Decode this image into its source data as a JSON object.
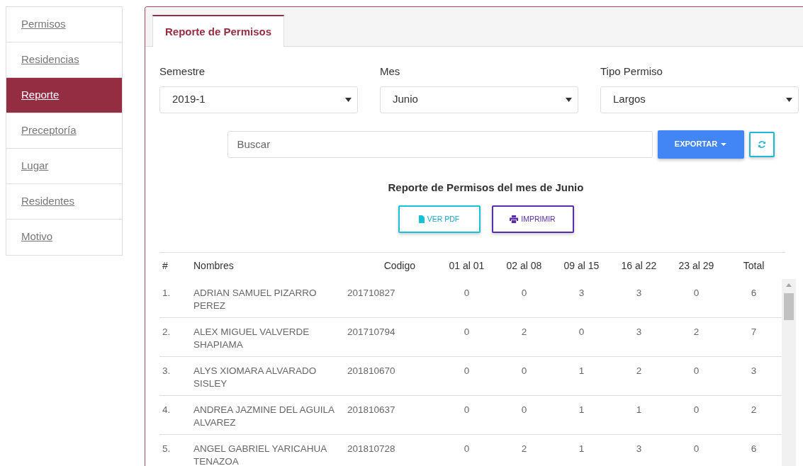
{
  "sidebar": {
    "items": [
      {
        "label": "Permisos",
        "selected": false
      },
      {
        "label": "Residencias",
        "selected": false
      },
      {
        "label": "Reporte",
        "selected": true
      },
      {
        "label": "Preceptoría",
        "selected": false
      },
      {
        "label": "Lugar",
        "selected": false
      },
      {
        "label": "Residentes",
        "selected": false
      },
      {
        "label": "Motivo",
        "selected": false
      }
    ]
  },
  "tabs": [
    {
      "label": "Reporte de Permisos",
      "selected": true
    }
  ],
  "filters": [
    {
      "label": "Semestre",
      "value": "2019-1"
    },
    {
      "label": "Mes",
      "value": "Junio"
    },
    {
      "label": "Tipo Permiso",
      "value": "Largos"
    }
  ],
  "search": {
    "placeholder": "Buscar"
  },
  "export_button": {
    "label": "EXPORTAR"
  },
  "report_title": "Reporte de Permisos del mes de Junio",
  "report_buttons": [
    {
      "kind": "pdf",
      "label": "VER PDF"
    },
    {
      "kind": "print",
      "label": "IMPRIMIR"
    }
  ],
  "table": {
    "columns": [
      "#",
      "Nombres",
      "Codigo",
      "01 al 01",
      "02 al 08",
      "09 al 15",
      "16 al 22",
      "23 al 29",
      "Total"
    ],
    "rows": [
      [
        "1.",
        "ADRIAN SAMUEL PIZARRO PEREZ",
        "201710827",
        "0",
        "0",
        "3",
        "3",
        "0",
        "6"
      ],
      [
        "2.",
        "ALEX MIGUEL VALVERDE SHAPIAMA",
        "201710794",
        "0",
        "2",
        "0",
        "3",
        "2",
        "7"
      ],
      [
        "3.",
        "ALYS XIOMARA ALVARADO SISLEY",
        "201810670",
        "0",
        "0",
        "1",
        "2",
        "0",
        "3"
      ],
      [
        "4.",
        "ANDREA JAZMINE DEL AGUILA ALVAREZ",
        "201810637",
        "0",
        "0",
        "1",
        "1",
        "0",
        "2"
      ],
      [
        "5.",
        "ANGEL GABRIEL YARICAHUA TENAZOA",
        "201810728",
        "0",
        "2",
        "1",
        "3",
        "0",
        "6"
      ]
    ]
  }
}
